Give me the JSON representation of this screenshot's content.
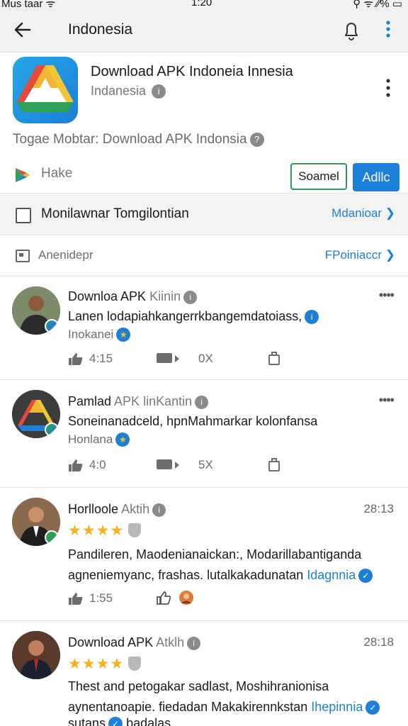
{
  "status_bar": {
    "left": "Mus taar ᯤ",
    "time": "1:20",
    "right": "⚲ ᯤ ⁄⁄% ▭"
  },
  "header": {
    "title": "Indonesia"
  },
  "app": {
    "title": "Download APK Indoneia  Innesia",
    "subtitle": "Indanesia",
    "subtitle_badge": "i",
    "description": "Togae Mobtar: Download APK Indonsia",
    "description_badge": "?",
    "make_label": "Hake",
    "secondary_button": "Soamel",
    "primary_button": "Adllc"
  },
  "filter_row": {
    "label": "Monilawnar Tomgilontian",
    "link": "Mdanioar ❯"
  },
  "section_row": {
    "label": "Anenidepr",
    "link": "FPoiniaccr ❯"
  },
  "posts": [
    {
      "name": "Downloa APK",
      "tag": "Kiinin",
      "badge": "i",
      "text": "Lanen lodapiahkangerrkbangemdatoiass,",
      "sub": "Inokanei",
      "likes": "4:15",
      "comments": "0X",
      "menu": "••••"
    },
    {
      "name": "Pamlad",
      "tag": "APK linKantin",
      "badge": "i",
      "text": "Soneinanadceld, hpnMahmarkar kolonfansa",
      "sub": "Honlana",
      "likes": "4:0",
      "comments": "5X",
      "menu": "••••"
    },
    {
      "name": "Horlloole",
      "tag": "Aktih",
      "badge": "i",
      "date": "28:13",
      "rating": 4,
      "text": "Pandileren, Maodenianaickan:, Modarillabantiganda agneniemyanc, frashas. lutalkakadunatan",
      "link": "Idagnnia",
      "likes": "1:55"
    },
    {
      "name": "Download APK",
      "tag": "Atklh",
      "badge": "i",
      "date": "28:18",
      "rating": 4,
      "text": "Thest and  petogakar sadlast, Moshihranionisa aynentanoapie. fiedadan Makakirennkstan",
      "link": "Ihepinnia",
      "extra": "sutans",
      "extra2": "badalas"
    }
  ],
  "colors": {
    "accent": "#1d7fd6",
    "outline_button": "#2f9a5a",
    "star": "#f5b21b"
  }
}
